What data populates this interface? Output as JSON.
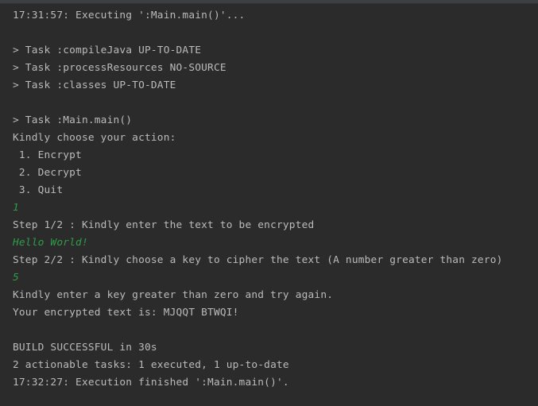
{
  "colors": {
    "background": "#2b2b2b",
    "text": "#bbbbbb",
    "user_input": "#2f9c48"
  },
  "console": {
    "lines": [
      {
        "text": "17:31:57: Executing ':Main.main()'...",
        "kind": "output"
      },
      {
        "text": "",
        "kind": "output"
      },
      {
        "text": "> Task :compileJava UP-TO-DATE",
        "kind": "output"
      },
      {
        "text": "> Task :processResources NO-SOURCE",
        "kind": "output"
      },
      {
        "text": "> Task :classes UP-TO-DATE",
        "kind": "output"
      },
      {
        "text": "",
        "kind": "output"
      },
      {
        "text": "> Task :Main.main()",
        "kind": "output"
      },
      {
        "text": "Kindly choose your action:",
        "kind": "output"
      },
      {
        "text": " 1. Encrypt",
        "kind": "output"
      },
      {
        "text": " 2. Decrypt",
        "kind": "output"
      },
      {
        "text": " 3. Quit",
        "kind": "output"
      },
      {
        "text": "1",
        "kind": "input"
      },
      {
        "text": "Step 1/2 : Kindly enter the text to be encrypted",
        "kind": "output"
      },
      {
        "text": "Hello World!",
        "kind": "input"
      },
      {
        "text": "Step 2/2 : Kindly choose a key to cipher the text (A number greater than zero)",
        "kind": "output"
      },
      {
        "text": "5",
        "kind": "input"
      },
      {
        "text": "Kindly enter a key greater than zero and try again.",
        "kind": "output"
      },
      {
        "text": "Your encrypted text is: MJQQT BTWQI!",
        "kind": "output"
      },
      {
        "text": "",
        "kind": "output"
      },
      {
        "text": "BUILD SUCCESSFUL in 30s",
        "kind": "output"
      },
      {
        "text": "2 actionable tasks: 1 executed, 1 up-to-date",
        "kind": "output"
      },
      {
        "text": "17:32:27: Execution finished ':Main.main()'.",
        "kind": "output"
      }
    ]
  }
}
